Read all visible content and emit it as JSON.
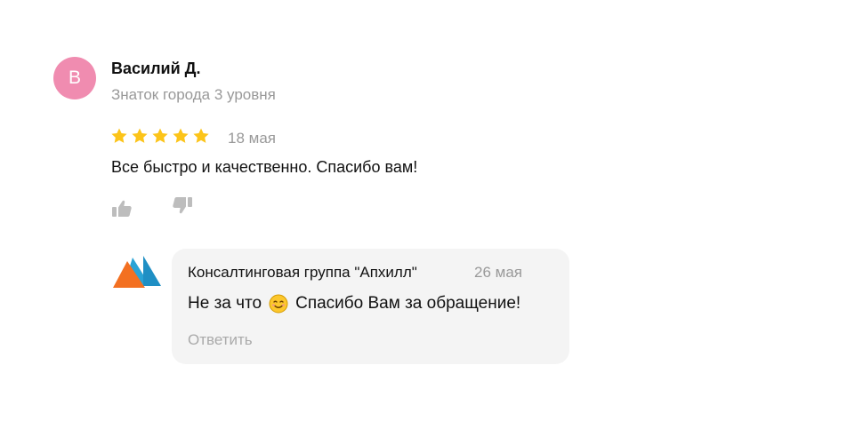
{
  "review": {
    "avatar_letter": "В",
    "avatar_color": "#f08cb0",
    "author_name": "Василий Д.",
    "author_level": "Знаток города 3 уровня",
    "rating": 5,
    "rating_max": 5,
    "star_color": "#fcc419",
    "date": "18 мая",
    "text": "Все быстро и качественно. Спасибо вам!",
    "like_icon": "thumbs-up-icon",
    "dislike_icon": "thumbs-down-icon"
  },
  "reply": {
    "logo_icon": "company-logo-triangles",
    "org_name": "Консалтинговая группа \"Апхилл\"",
    "date": "26 мая",
    "text_before": "Не за что",
    "emoji_icon": "smiling-face-emoji",
    "text_after": "Спасибо Вам за обращение!",
    "answer_label": "Ответить"
  }
}
